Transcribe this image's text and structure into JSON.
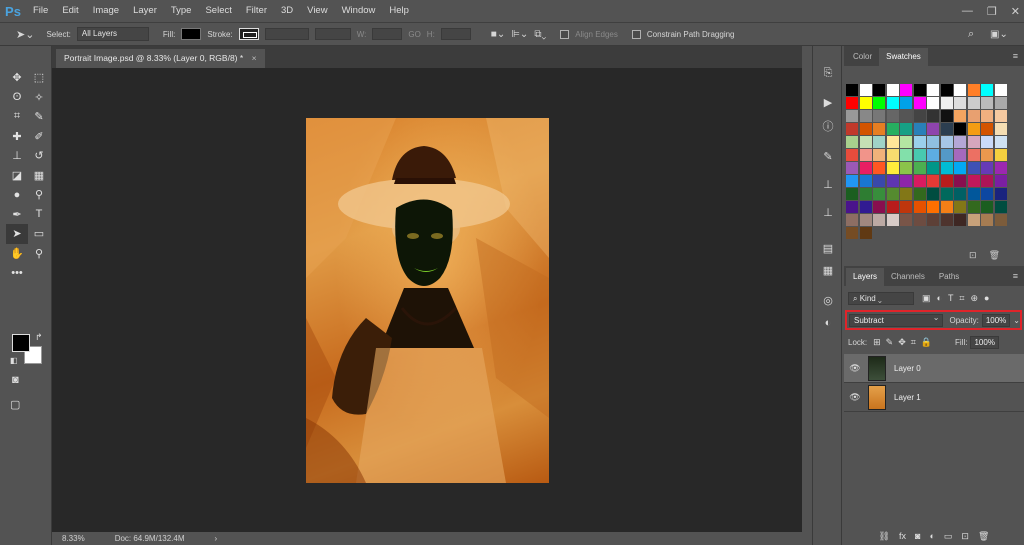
{
  "menubar": {
    "logo": "Ps",
    "items": [
      "File",
      "Edit",
      "Image",
      "Layer",
      "Type",
      "Select",
      "Filter",
      "3D",
      "View",
      "Window",
      "Help"
    ],
    "window_controls": [
      "—",
      "❐",
      "✕"
    ]
  },
  "options_bar": {
    "select_label": "Select:",
    "select_value": "All Layers",
    "fill_label": "Fill:",
    "stroke_label": "Stroke:",
    "w_label": "W:",
    "go_label": "GO",
    "h_label": "H:",
    "align_edges": "Align Edges",
    "constrain_path": "Constrain Path Dragging"
  },
  "document": {
    "tab_title": "Portrait Image.psd @ 8.33% (Layer 0, RGB/8) *",
    "tab_close": "×",
    "zoom": "8.33%",
    "doc_info": "Doc: 64.9M/132.4M"
  },
  "swatches_panel": {
    "tabs": [
      "Color",
      "Swatches"
    ],
    "active_tab": "Swatches",
    "colors": [
      "#000000",
      "#ffffff",
      "#000000",
      "#ffffff",
      "#ff00ff",
      "#000000",
      "#ffffff",
      "#000000",
      "#ffffff",
      "#ff7f27",
      "#00ffff",
      "#ffffff",
      "#ff0000",
      "#ffff00",
      "#00ff00",
      "#00ffff",
      "#00a2e8",
      "#ff00ff",
      "#ffffff",
      "#eeeeee",
      "#dddddd",
      "#cccccc",
      "#bbbbbb",
      "#aaaaaa",
      "#999999",
      "#888888",
      "#777777",
      "#666666",
      "#555555",
      "#444444",
      "#333333",
      "#111111",
      "#f4a460",
      "#e8a070",
      "#f0b080",
      "#f5c9a0",
      "#c0392b",
      "#d35400",
      "#e67e22",
      "#27ae60",
      "#16a085",
      "#2980b9",
      "#8e44ad",
      "#2c3e50",
      "#000000",
      "#f39c12",
      "#d35400",
      "#f5deb3",
      "#a8d08d",
      "#c5e0b4",
      "#9fd3c7",
      "#ffe699",
      "#b4e5a2",
      "#9ad0ec",
      "#8fbfe0",
      "#a7c7e7",
      "#b4a7d6",
      "#d5a6bd",
      "#c9daf8",
      "#cfe2f3",
      "#e74c3c",
      "#f1948a",
      "#f0b27a",
      "#f7dc6f",
      "#82e0aa",
      "#48c9b0",
      "#5dade2",
      "#5499c7",
      "#a569bd",
      "#ec7063",
      "#eb984e",
      "#f4d03f",
      "#9b59b6",
      "#e91e63",
      "#ff5722",
      "#ffeb3b",
      "#8bc34a",
      "#4caf50",
      "#009688",
      "#00bcd4",
      "#03a9f4",
      "#3f51b5",
      "#673ab7",
      "#9c27b0",
      "#2196f3",
      "#1976d2",
      "#3949ab",
      "#5e35b1",
      "#8e24aa",
      "#d81b60",
      "#e53935",
      "#b71c1c",
      "#880e4f",
      "#c2185b",
      "#ad1457",
      "#7b1fa2",
      "#1b5e20",
      "#2e7d32",
      "#388e3c",
      "#558b2f",
      "#827717",
      "#33691e",
      "#004d40",
      "#00695c",
      "#006064",
      "#01579b",
      "#0d47a1",
      "#1a237e",
      "#4a148c",
      "#311b92",
      "#880e4f",
      "#b71c1c",
      "#bf360c",
      "#e65100",
      "#ff6f00",
      "#f57f17",
      "#827717",
      "#33691e",
      "#1b5e20",
      "#004d40",
      "#8d6e63",
      "#a1887f",
      "#bcaaa4",
      "#d7ccc8",
      "#795548",
      "#6d4c41",
      "#5d4037",
      "#4e342e",
      "#3e2723",
      "#c7a17a",
      "#a67c52",
      "#7c5c3b",
      "#754c24",
      "#603913"
    ]
  },
  "layers_panel": {
    "tabs": [
      "Layers",
      "Channels",
      "Paths"
    ],
    "active_tab": "Layers",
    "kind": "Kind",
    "blend_mode": "Subtract",
    "opacity_label": "Opacity:",
    "opacity_value": "100%",
    "lock_label": "Lock:",
    "fill_label": "Fill:",
    "fill_value": "100%",
    "layers": [
      {
        "name": "Layer 0",
        "active": true
      },
      {
        "name": "Layer 1",
        "active": false
      }
    ]
  }
}
